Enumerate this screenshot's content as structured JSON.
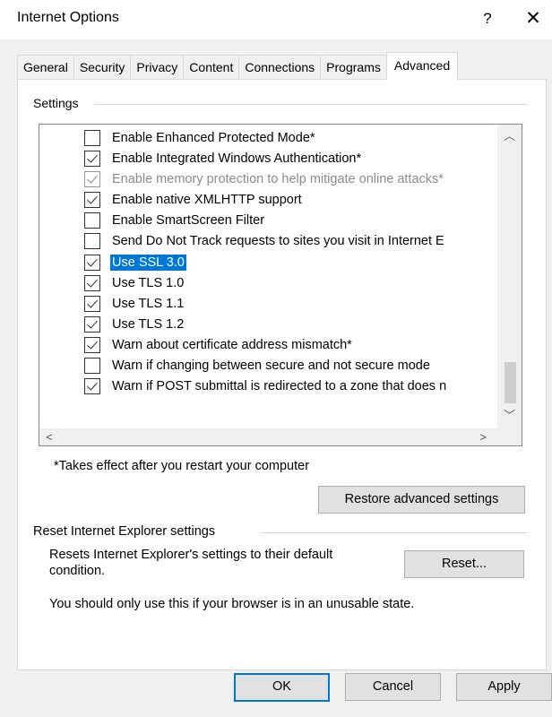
{
  "window": {
    "title": "Internet Options",
    "help_label": "?",
    "close_label": "✕"
  },
  "tabs": [
    {
      "label": "General",
      "active": false
    },
    {
      "label": "Security",
      "active": false
    },
    {
      "label": "Privacy",
      "active": false
    },
    {
      "label": "Content",
      "active": false
    },
    {
      "label": "Connections",
      "active": false
    },
    {
      "label": "Programs",
      "active": false
    },
    {
      "label": "Advanced",
      "active": true
    }
  ],
  "settings_group": {
    "label": "Settings",
    "items": [
      {
        "label": "Enable Enhanced Protected Mode*",
        "checked": false,
        "disabled": false,
        "selected": false
      },
      {
        "label": "Enable Integrated Windows Authentication*",
        "checked": true,
        "disabled": false,
        "selected": false
      },
      {
        "label": "Enable memory protection to help mitigate online attacks*",
        "checked": true,
        "disabled": true,
        "selected": false
      },
      {
        "label": "Enable native XMLHTTP support",
        "checked": true,
        "disabled": false,
        "selected": false
      },
      {
        "label": "Enable SmartScreen Filter",
        "checked": false,
        "disabled": false,
        "selected": false
      },
      {
        "label": "Send Do Not Track requests to sites you visit in Internet E",
        "checked": false,
        "disabled": false,
        "selected": false
      },
      {
        "label": "Use SSL 3.0",
        "checked": true,
        "disabled": false,
        "selected": true
      },
      {
        "label": "Use TLS 1.0",
        "checked": true,
        "disabled": false,
        "selected": false
      },
      {
        "label": "Use TLS 1.1",
        "checked": true,
        "disabled": false,
        "selected": false
      },
      {
        "label": "Use TLS 1.2",
        "checked": true,
        "disabled": false,
        "selected": false
      },
      {
        "label": "Warn about certificate address mismatch*",
        "checked": true,
        "disabled": false,
        "selected": false
      },
      {
        "label": "Warn if changing between secure and not secure mode",
        "checked": false,
        "disabled": false,
        "selected": false
      },
      {
        "label": "Warn if POST submittal is redirected to a zone that does n",
        "checked": true,
        "disabled": false,
        "selected": false
      }
    ],
    "note": "*Takes effect after you restart your computer",
    "restore_button": "Restore advanced settings"
  },
  "reset_group": {
    "label": "Reset Internet Explorer settings",
    "description_line1": "Resets Internet Explorer's settings to their default",
    "description_line2": "condition.",
    "reset_button": "Reset...",
    "warning": "You should only use this if your browser is in an unusable state."
  },
  "footer": {
    "ok": "OK",
    "cancel": "Cancel",
    "apply": "Apply"
  },
  "colors": {
    "accent": "#0078d7",
    "dialog_background": "#f0f0f0",
    "panel_background": "#ffffff"
  }
}
